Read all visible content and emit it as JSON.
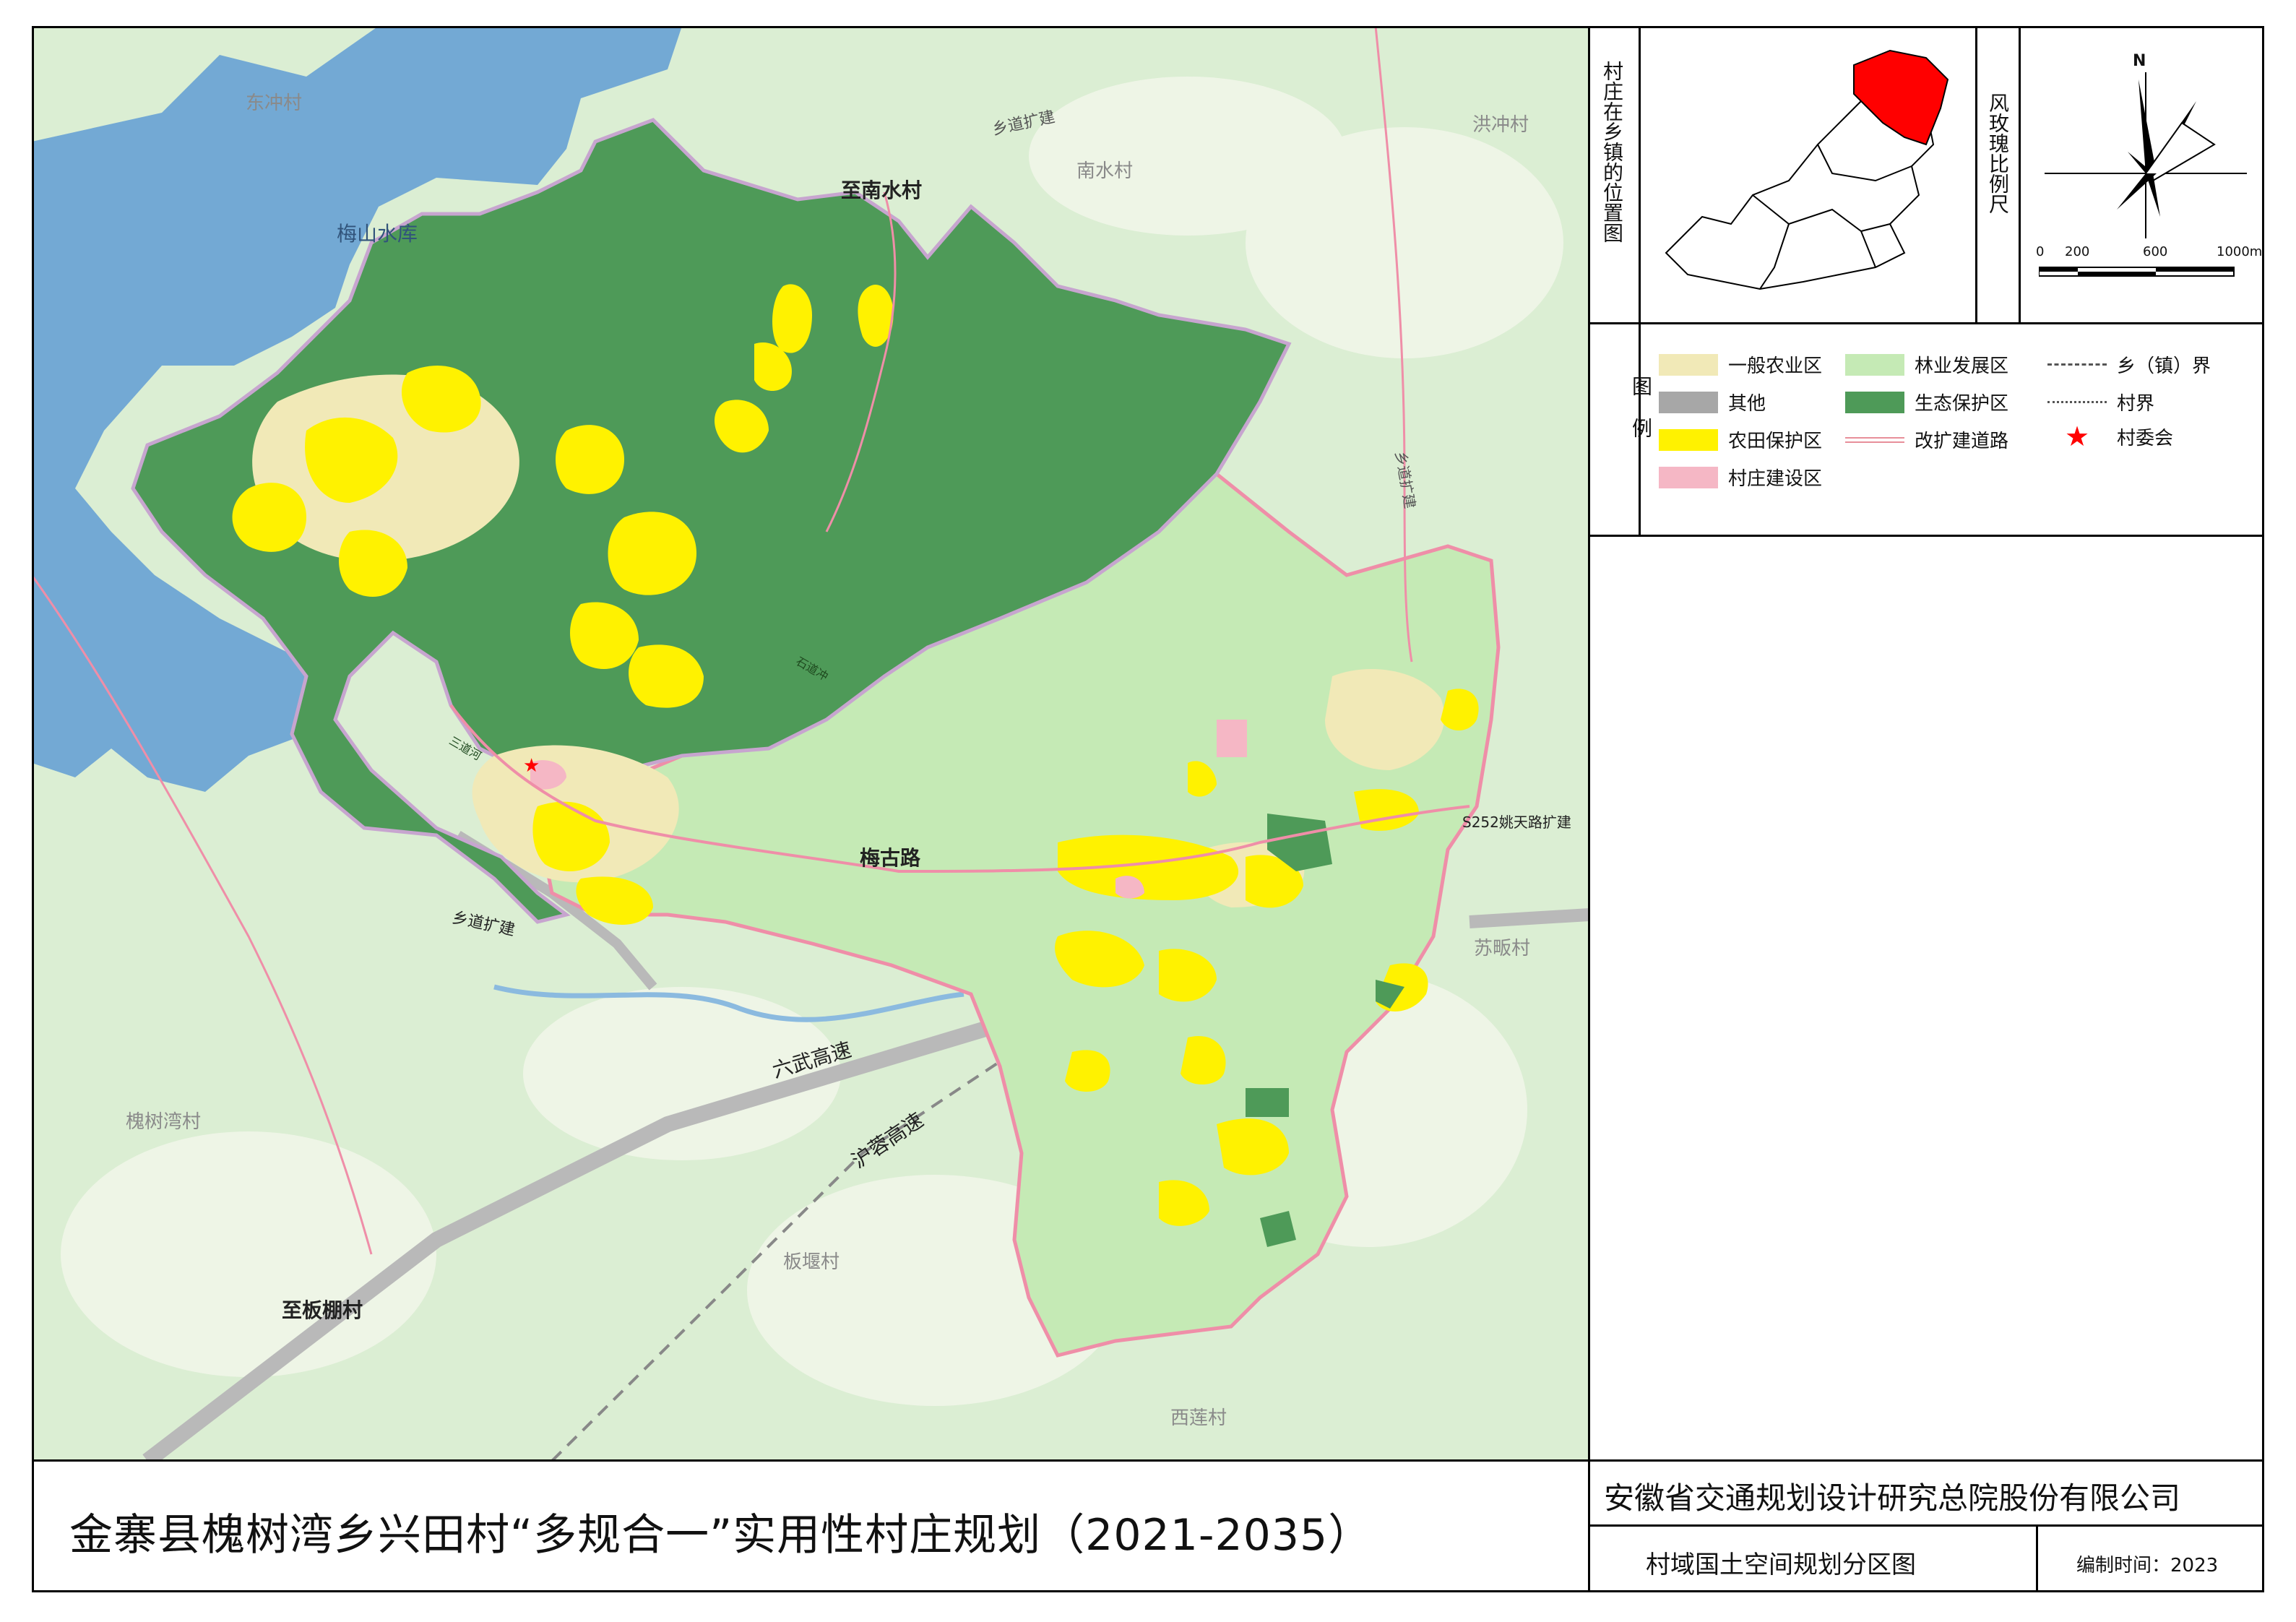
{
  "title": "金寨县槐树湾乡兴田村“多规合一”实用性村庄规划（2021-2035）",
  "company": "安徽省交通规划设计研究总院股份有限公司",
  "subtitle": "村域国土空间规划分区图",
  "date_text": "编制时间：2023",
  "location_map": {
    "label": "村庄在乡镇的位置图"
  },
  "compass": {
    "label": "风玫瑰比例尺",
    "north": "N"
  },
  "scale_bar": {
    "ticks": [
      "0",
      "200",
      "600",
      "1000m"
    ]
  },
  "legend": {
    "label": "图例",
    "items": [
      {
        "label": "一般农业区",
        "color": "#f1e9b7",
        "kind": "fill"
      },
      {
        "label": "林业发展区",
        "color": "#c5eab5",
        "kind": "fill"
      },
      {
        "label": "乡（镇）界",
        "color": "#555555",
        "kind": "dash"
      },
      {
        "label": "其他",
        "color": "#a7a7a7",
        "kind": "fill"
      },
      {
        "label": "生态保护区",
        "color": "#4e9a58",
        "kind": "fill"
      },
      {
        "label": "村界",
        "color": "#555555",
        "kind": "dot"
      },
      {
        "label": "农田保护区",
        "color": "#fff200",
        "kind": "fill"
      },
      {
        "label": "改扩建道路",
        "color": "#e88f9a",
        "kind": "road"
      },
      {
        "label": "村委会",
        "color": "#ff0000",
        "kind": "star"
      },
      {
        "label": "村庄建设区",
        "color": "#f5b7c5",
        "kind": "fill"
      }
    ]
  },
  "map_labels": {
    "dongchong": "东冲村",
    "meishan": "梅山水库",
    "zhinanshui": "至南水村",
    "xiangdao_top": "乡道扩建",
    "nanshui": "南水村",
    "hongchong": "洪冲村",
    "xiangdao_right": "乡道扩建",
    "meigu": "梅古路",
    "s252": "S252姚天路扩建",
    "sufan": "苏畈村",
    "xiangdao_left": "乡道扩建",
    "liuwu": "六武高速",
    "hurong": "沪蓉高速",
    "huaishuwan": "槐树湾村",
    "banyan": "板堰村",
    "zhibanpeng": "至板棚村",
    "xilian": "西莲村",
    "sanli": "三道河",
    "shidao": "石道冲"
  }
}
